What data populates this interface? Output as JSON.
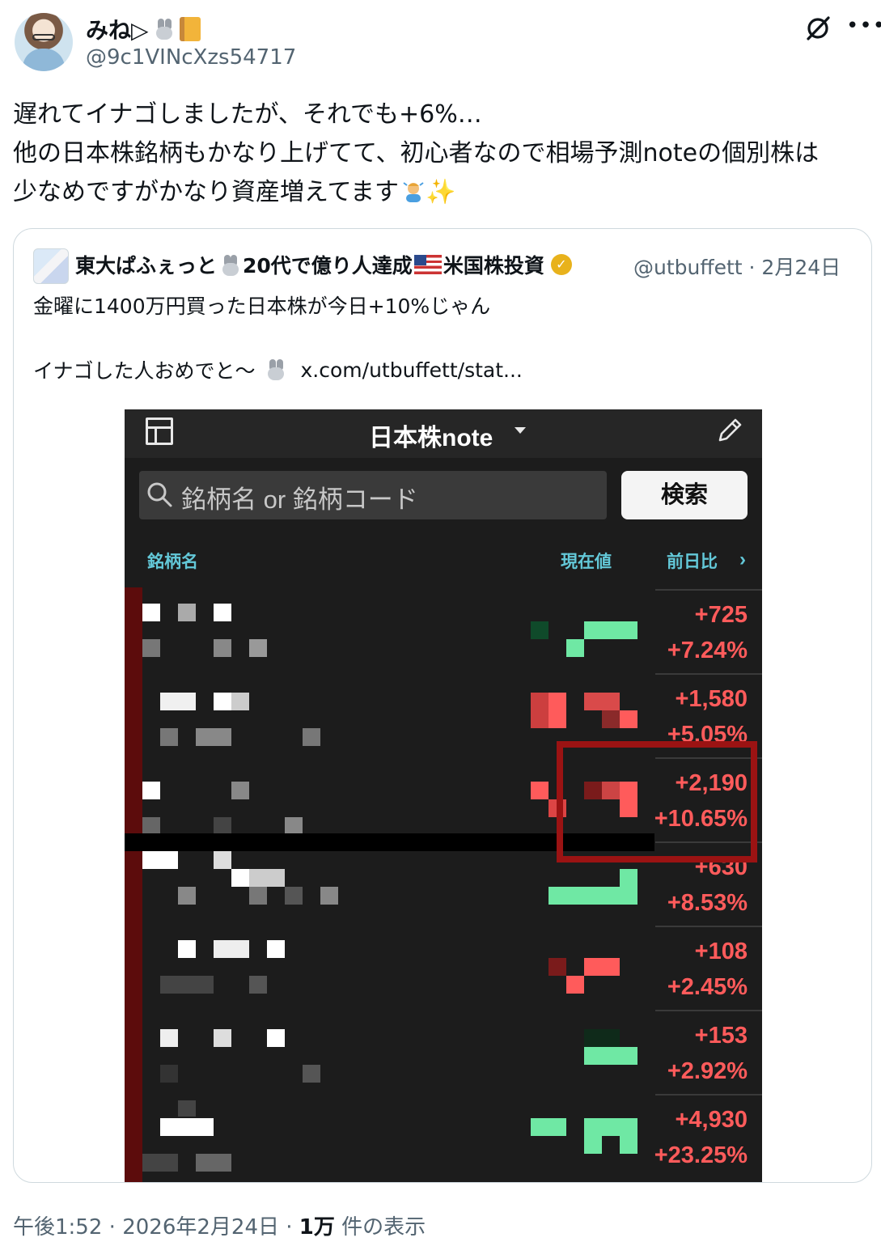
{
  "author": {
    "display_name": "みね▷",
    "handle": "@9c1VINcXzs54717"
  },
  "tweet": {
    "lines": [
      "遅れてイナゴしましたが、それでも+6%…",
      "他の日本株銘柄もかなり上げてて、初心者なので相場予測noteの個別株は",
      "少なめですがかなり資産増えてます"
    ]
  },
  "quote": {
    "name_part1": "東大ぱふぇっと",
    "name_part2": "20代で億り人達成",
    "name_part3": "米国株投資",
    "handle": "@utbuffett",
    "date": "2月24日",
    "text1": "金曜に1400万円買った日本株が今日+10%じゃん",
    "text2": "イナゴした人おめでと〜",
    "link": "x.com/utbuffett/stat..."
  },
  "app": {
    "title": "日本株note",
    "search_placeholder": "銘柄名 or 銘柄コード",
    "search_button": "検索",
    "col_name": "銘柄名",
    "col_price": "現在値",
    "col_change": "前日比",
    "rows": [
      {
        "abs": "+725",
        "pct": "+7.24%"
      },
      {
        "abs": "+1,580",
        "pct": "+5.05%"
      },
      {
        "abs": "+2,190",
        "pct": "+10.65%"
      },
      {
        "abs": "+630",
        "pct": "+8.53%"
      },
      {
        "abs": "+108",
        "pct": "+2.45%"
      },
      {
        "abs": "+153",
        "pct": "+2.92%"
      },
      {
        "abs": "+4,930",
        "pct": "+23.25%"
      }
    ]
  },
  "footer": {
    "time": "午後1:52",
    "date": "2026年2月24日",
    "views_count": "1万",
    "views_label": "件の表示"
  },
  "colors": {
    "up_red": "#ff5b5b",
    "mosaic_green": "#6fe8a4",
    "header_cyan": "#63c8d8",
    "highlight_border": "#9b1313"
  }
}
